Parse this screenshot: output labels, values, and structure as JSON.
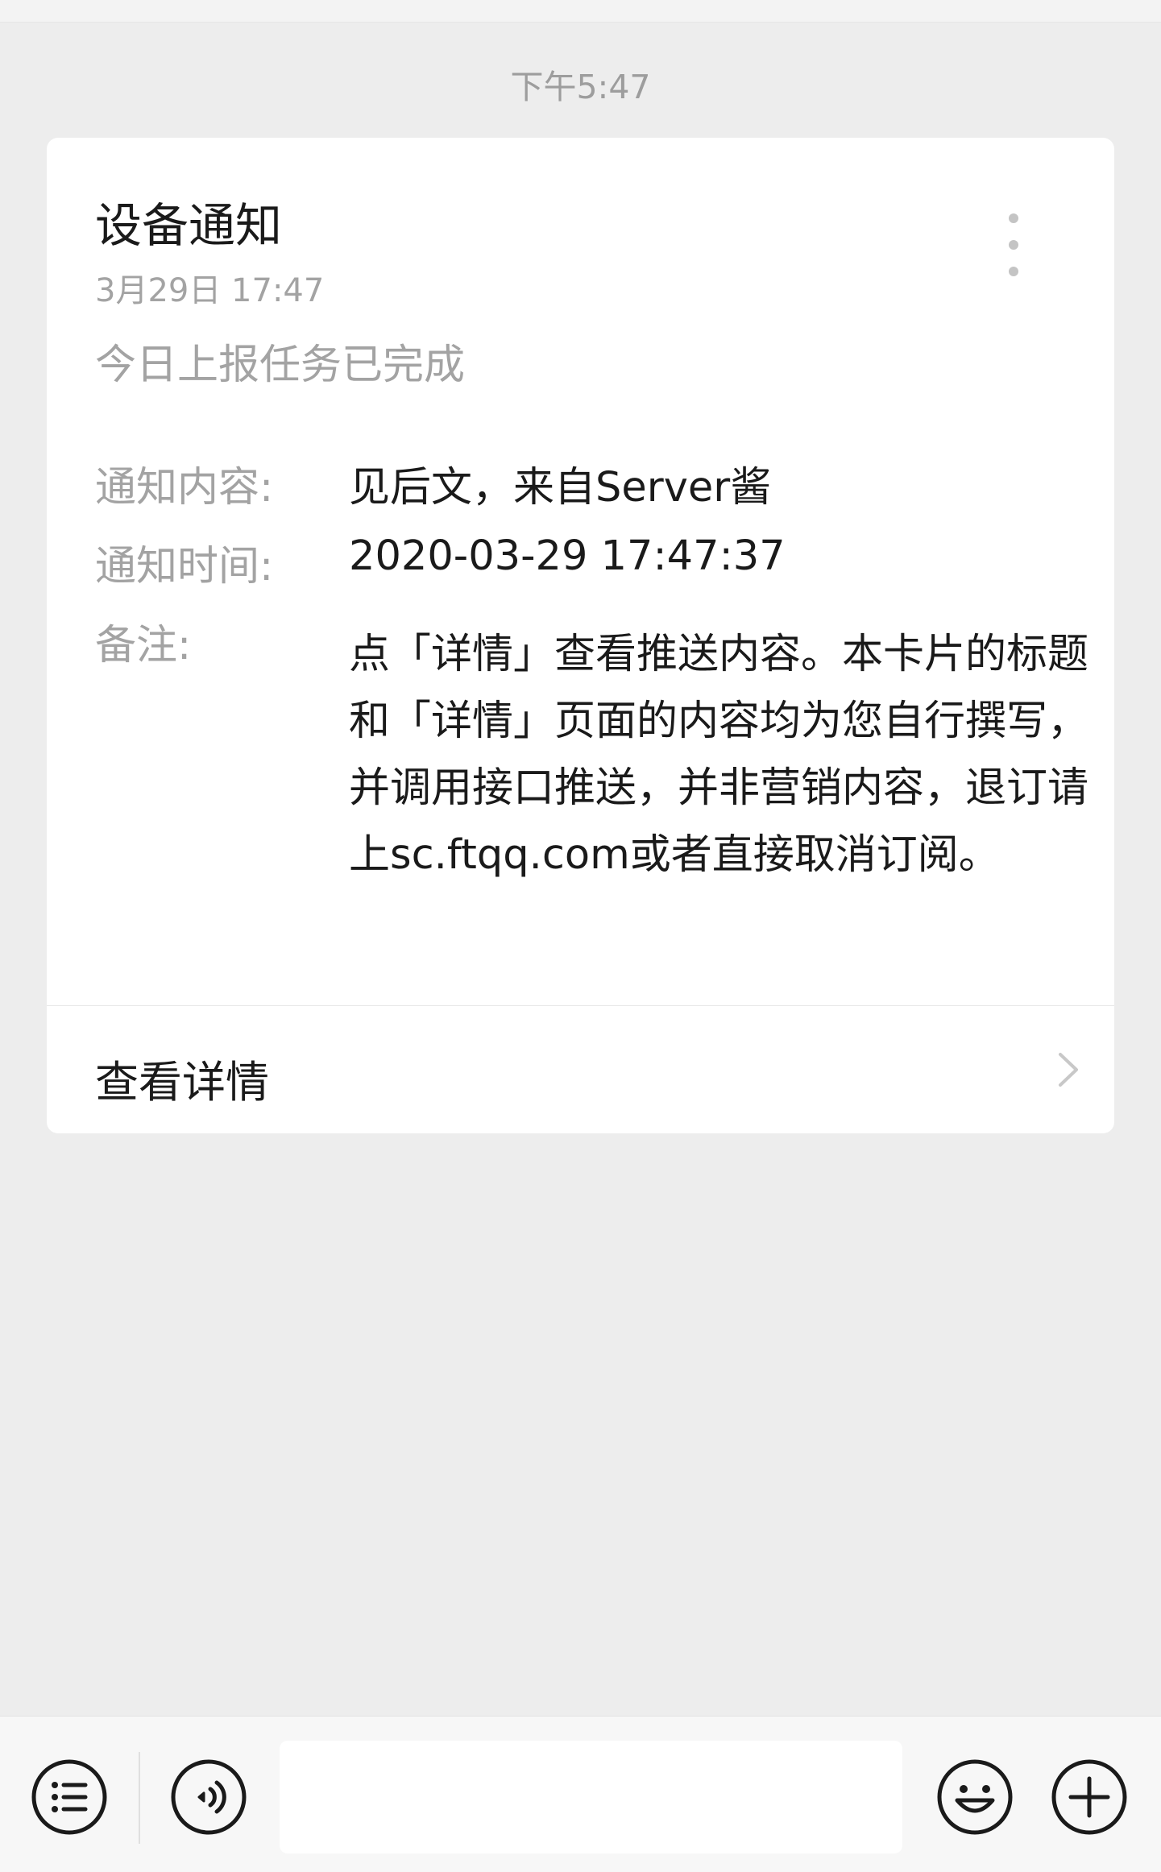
{
  "header": {
    "time": "下午5:47"
  },
  "card": {
    "title": "设备通知",
    "date": "3月29日  17:47",
    "subtitle": "今日上报任务已完成",
    "fields": [
      {
        "label": "通知内容:",
        "value": "见后文，来自Server酱"
      },
      {
        "label": "通知时间:",
        "value": "2020-03-29 17:47:37"
      },
      {
        "label": "备注:",
        "value": "点「详情」查看推送内容。本卡片的标题和「详情」页面的内容均为您自行撰写，并调用接口推送，并非营销内容，退订请上sc.ftqq.com或者直接取消订阅。"
      }
    ],
    "detail_label": "查看详情"
  },
  "input_bar": {
    "placeholder": "",
    "icons": [
      "menu-list-icon",
      "voice-icon",
      "emoji-icon",
      "plus-icon"
    ]
  },
  "colors": {
    "background": "#ededed",
    "card": "#ffffff",
    "text_primary": "#1a1a1a",
    "text_secondary": "#a3a3a3",
    "icon": "#1a1a1a"
  }
}
